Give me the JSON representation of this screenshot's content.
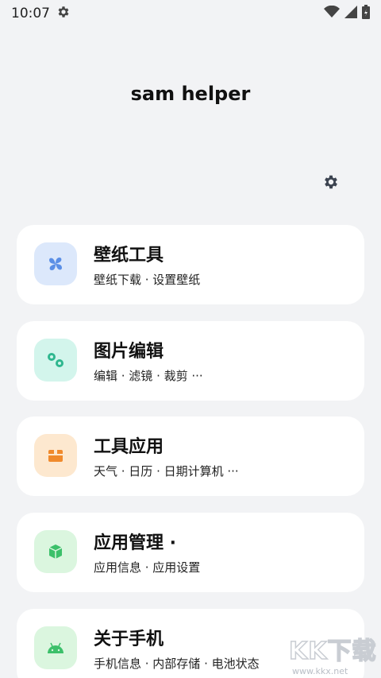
{
  "status": {
    "time": "10:07"
  },
  "app": {
    "title": "sam helper"
  },
  "cards": [
    {
      "title": "壁纸工具",
      "subtitle": "壁纸下载 · 设置壁纸",
      "icon": "fan-icon",
      "bg": "#dce8fb",
      "fg": "#5b8fe6"
    },
    {
      "title": "图片编辑",
      "subtitle": "编辑 · 滤镜 · 裁剪 ···",
      "icon": "gears-icon",
      "bg": "#d3f5ec",
      "fg": "#2fb78f"
    },
    {
      "title": "工具应用",
      "subtitle": "天气 · 日历 · 日期计算机 ···",
      "icon": "box-icon",
      "bg": "#fde8cf",
      "fg": "#f08a2c"
    },
    {
      "title": "应用管理 ·",
      "subtitle": "应用信息 · 应用设置",
      "icon": "cube-icon",
      "bg": "#dbf6df",
      "fg": "#3cc06a"
    },
    {
      "title": "关于手机",
      "subtitle": "手机信息 · 内部存储 · 电池状态",
      "icon": "android-icon",
      "bg": "#dbf6df",
      "fg": "#3cc06a"
    }
  ],
  "watermark": {
    "text": "KK下载",
    "url": "www.kkx.net"
  }
}
